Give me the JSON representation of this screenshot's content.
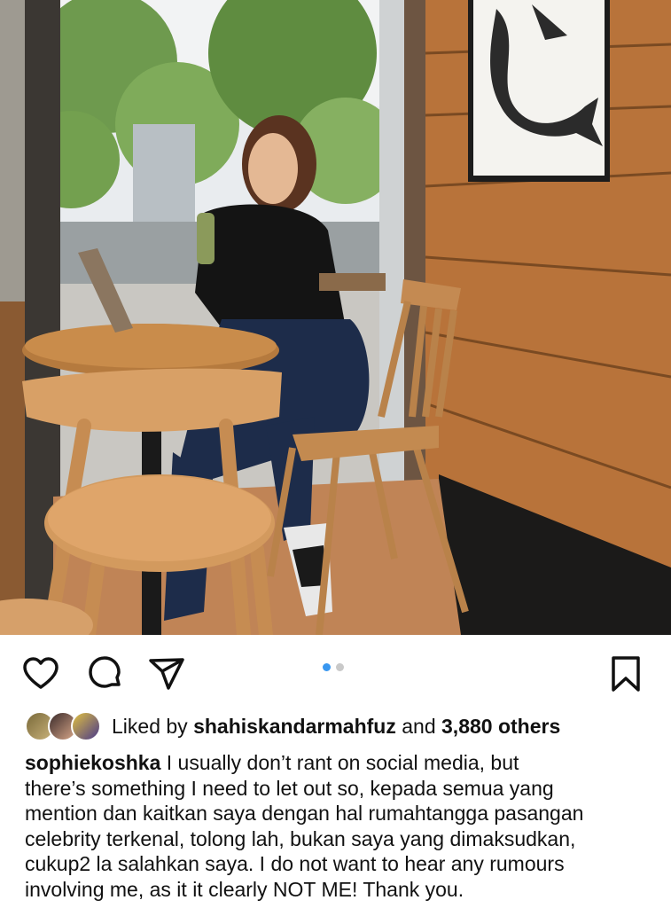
{
  "post": {
    "image_alt": "Woman seated at a wooden cafe table by a window holding a drink",
    "carousel": {
      "count": 2,
      "active_index": 0
    },
    "likes": {
      "prefix": "Liked by",
      "user": "shahiskandarmahfuz",
      "connector": "and",
      "others": "3,880 others"
    },
    "caption": {
      "username": "sophiekoshka",
      "lines": [
        "I usually don’t rant on social media, but",
        "there’s something I need to let out so, kepada  semua yang",
        "mention dan kaitkan saya dengan hal rumahtangga pasangan",
        "celebrity terkenal, tolong lah, bukan saya yang dimaksudkan,",
        "cukup2 la salahkan saya. I do not want to hear any rumours",
        "involving me, as it it clearly NOT ME! Thank you."
      ]
    }
  },
  "icons": {
    "like": "heart-icon",
    "comment": "comment-bubble-icon",
    "share": "paper-plane-icon",
    "save": "bookmark-icon"
  },
  "colors": {
    "accent_dot": "#3897f0",
    "inactive_dot": "#c9c9c9",
    "text": "#111111"
  }
}
